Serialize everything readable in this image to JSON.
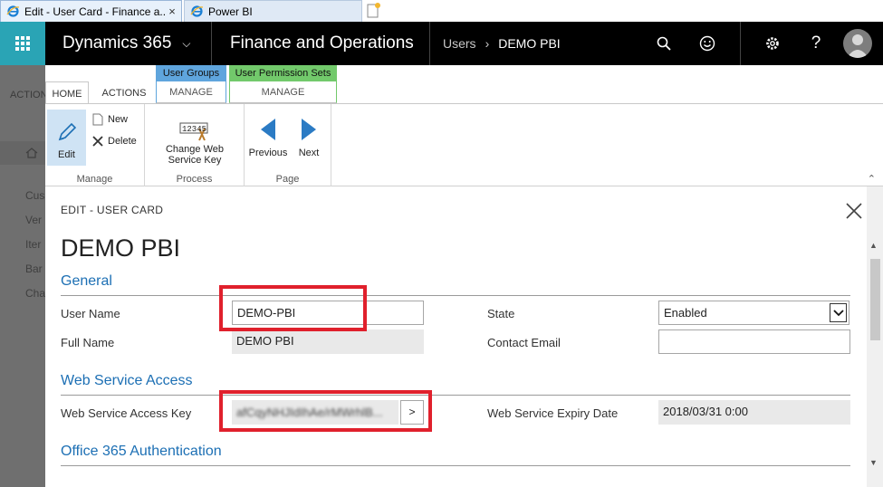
{
  "browser": {
    "tabs": [
      {
        "title": "Edit - User Card - Finance a...",
        "close": "×"
      },
      {
        "title": "Power BI"
      }
    ]
  },
  "navbar": {
    "brand": "Dynamics 365",
    "brand_chevron": "⌵",
    "module": "Finance and Operations",
    "breadcrumb": [
      "Users",
      "DEMO PBI"
    ]
  },
  "background_page": {
    "tab": "ACTION",
    "items": [
      "Cus",
      "Ver",
      "Iter",
      "Bar",
      "Cha"
    ]
  },
  "ribbon": {
    "tabs": {
      "home": "HOME",
      "actions": "ACTIONS"
    },
    "contextual": [
      {
        "header": "User Groups",
        "tab": "MANAGE",
        "color": "#5fa5dd"
      },
      {
        "header": "User Permission Sets",
        "tab": "MANAGE",
        "color": "#72c96b"
      }
    ],
    "groups": {
      "manage": {
        "label": "Manage",
        "edit": "Edit",
        "new": "New",
        "delete": "Delete"
      },
      "process": {
        "label": "Process",
        "change_key": "Change Web Service Key",
        "icon_text": "12345"
      },
      "page": {
        "label": "Page",
        "previous": "Previous",
        "next": "Next"
      }
    }
  },
  "dialog": {
    "title": "EDIT - USER CARD",
    "heading": "DEMO PBI",
    "general": {
      "section": "General",
      "user_name_label": "User Name",
      "user_name_value": "DEMO-PBI",
      "full_name_label": "Full Name",
      "full_name_value": "DEMO PBI",
      "state_label": "State",
      "state_value": "Enabled",
      "contact_email_label": "Contact Email",
      "contact_email_value": ""
    },
    "web_service": {
      "section": "Web Service Access",
      "key_label": "Web Service Access Key",
      "key_value": "afCqyNHJIdIhAe/rMWrhlB...",
      "key_button": ">",
      "expiry_label": "Web Service Expiry Date",
      "expiry_value": "2018/03/31 0:00"
    },
    "office365": {
      "section": "Office 365 Authentication"
    }
  },
  "colors": {
    "accent": "#2aa4b5",
    "section_blue": "#1c6fb4",
    "highlight_red": "#e0202c"
  }
}
